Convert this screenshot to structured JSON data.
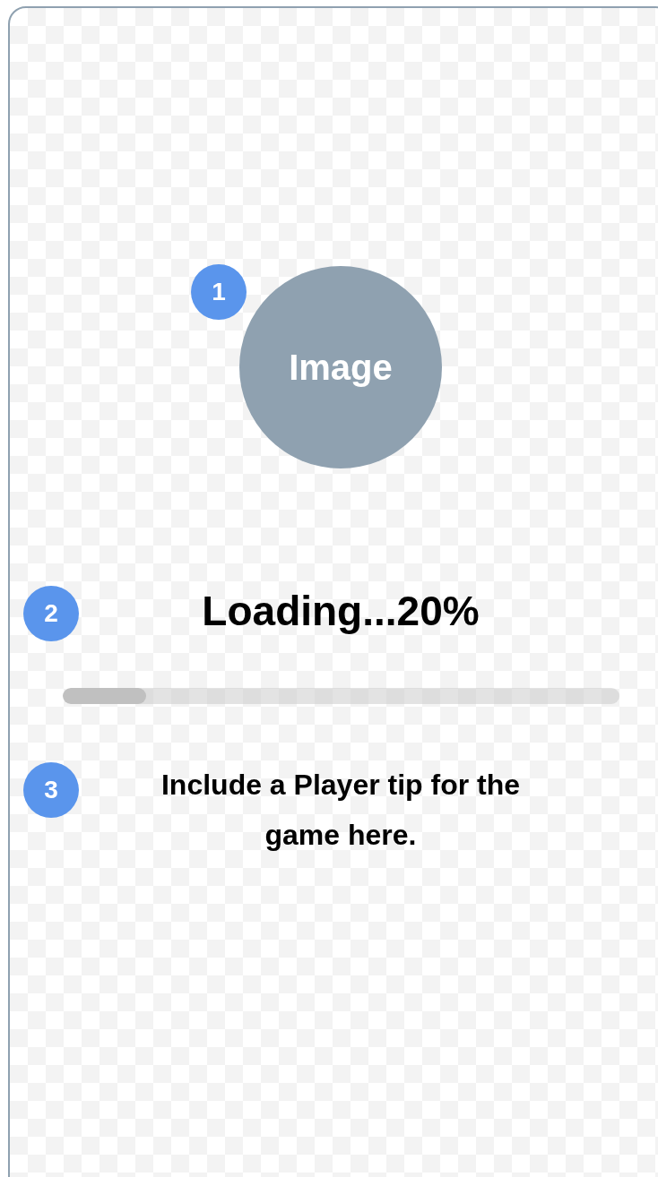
{
  "image_placeholder": {
    "label": "Image",
    "marker": "1"
  },
  "loading": {
    "text": "Loading...20%",
    "marker": "2",
    "level": 0.15
  },
  "tip": {
    "text": "Include a Player tip for the game here.",
    "marker": "3"
  }
}
